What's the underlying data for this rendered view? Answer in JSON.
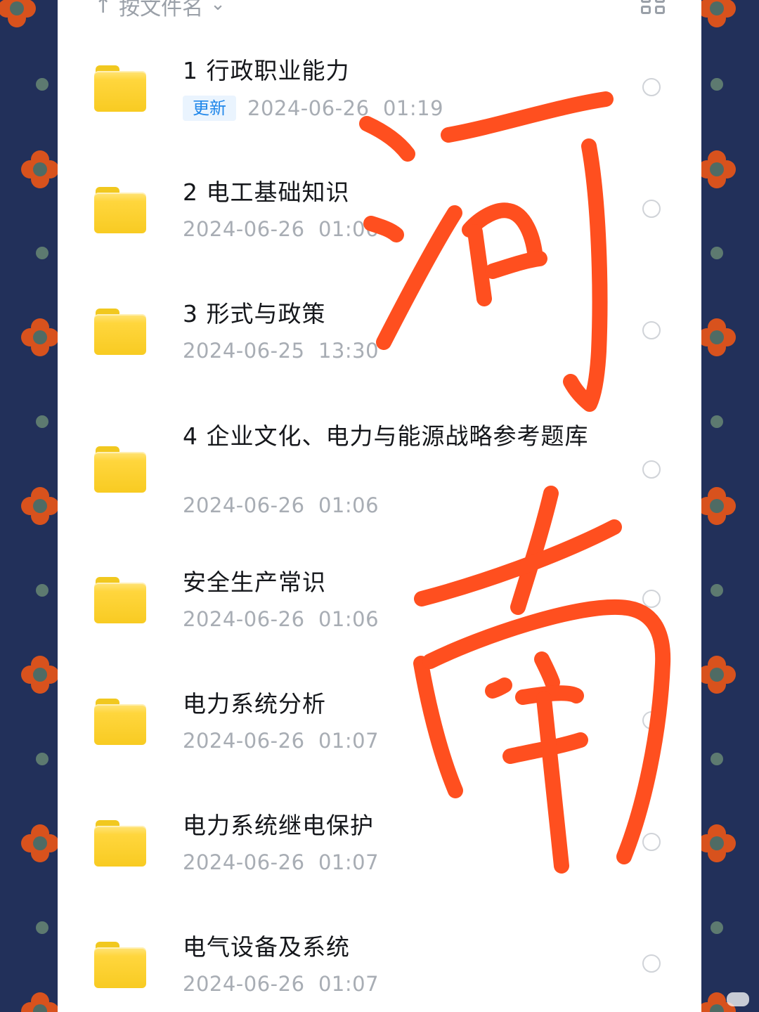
{
  "toolbar": {
    "sort_label": "按文件名",
    "sort_arrow_icon": "arrow-up-icon",
    "sort_dropdown_icon": "chevron-down-icon",
    "view_toggle_icon": "grid-view-icon"
  },
  "files": [
    {
      "name": "1 行政职业能力",
      "date": "2024-06-26  01:19",
      "badge": "更新"
    },
    {
      "name": "2 电工基础知识",
      "date": "2024-06-26  01:06"
    },
    {
      "name": "3 形式与政策",
      "date": "2024-06-25  13:30"
    },
    {
      "name": "4 企业文化、电力与能源战略参考题库",
      "date": "2024-06-26  01:06"
    },
    {
      "name": "安全生产常识",
      "date": "2024-06-26  01:06"
    },
    {
      "name": "电力系统分析",
      "date": "2024-06-26  01:07"
    },
    {
      "name": "电力系统继电保护",
      "date": "2024-06-26  01:07"
    },
    {
      "name": "电气设备及系统",
      "date": "2024-06-26  01:07"
    }
  ],
  "annotation": {
    "text": "河南",
    "color": "#ff4f1f"
  },
  "colors": {
    "folder": "#f8cb22",
    "badge_text": "#2288ea",
    "border_background": "#24305a",
    "flower": "#d8521d"
  }
}
